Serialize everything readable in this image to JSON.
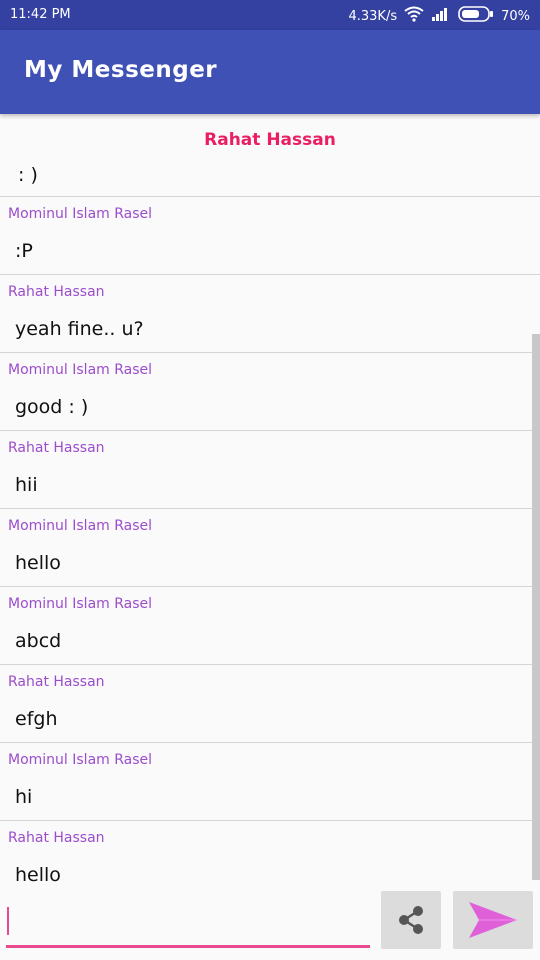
{
  "status_bar": {
    "time": "11:42 PM",
    "network_speed": "4.33K/s",
    "battery": "70%",
    "icons": [
      "wifi-icon",
      "signal-icon",
      "battery-icon"
    ],
    "battery_level": 0.7
  },
  "app_bar": {
    "title": "My Messenger",
    "color": "#3f51b5"
  },
  "conversation": {
    "top_partial": {
      "sender": "Rahat Hassan",
      "text": ": )"
    },
    "messages": [
      {
        "sender": "Mominul Islam Rasel",
        "text": ":P"
      },
      {
        "sender": "Rahat Hassan",
        "text": "yeah fine.. u?"
      },
      {
        "sender": "Mominul Islam Rasel",
        "text": "good : )"
      },
      {
        "sender": "Rahat Hassan",
        "text": "hii"
      },
      {
        "sender": "Mominul Islam Rasel",
        "text": "hello"
      },
      {
        "sender": "Mominul Islam Rasel",
        "text": "abcd"
      },
      {
        "sender": "Rahat Hassan",
        "text": "efgh"
      },
      {
        "sender": "Mominul Islam Rasel",
        "text": "hi"
      },
      {
        "sender": "Rahat Hassan",
        "text": "hello"
      }
    ],
    "sender_color": "#9c4dcc",
    "highlight_sender_color": "#e91e63"
  },
  "composer": {
    "input_value": "",
    "input_placeholder": "",
    "share_icon": "share-icon",
    "send_icon": "send-icon",
    "accent": "#e84a8d"
  }
}
